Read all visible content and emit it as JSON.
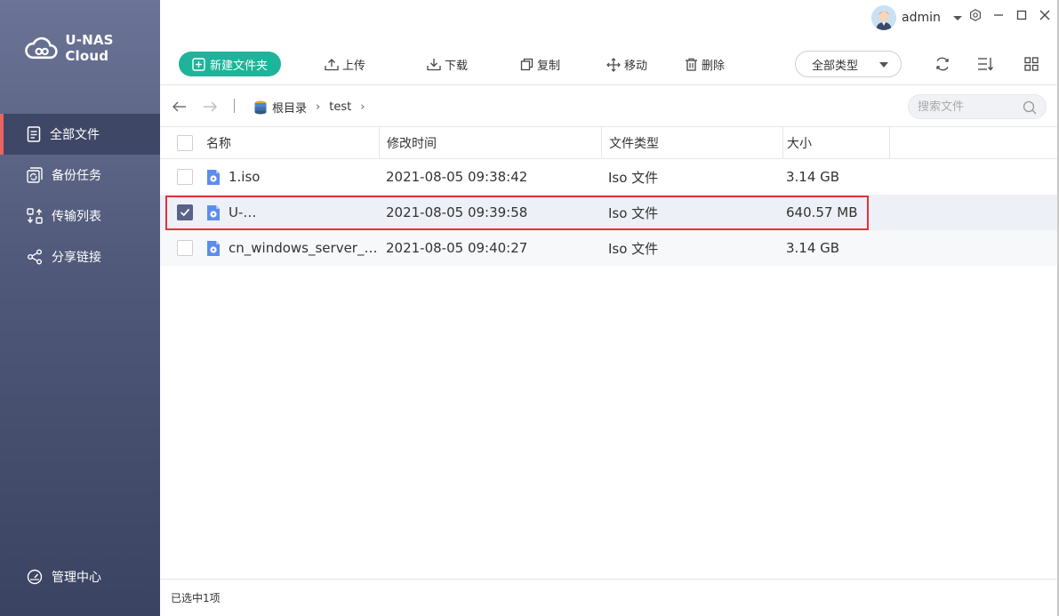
{
  "app": {
    "logo_text": "U-NAS Cloud"
  },
  "sidebar": {
    "items": [
      {
        "label": "全部文件",
        "icon": "document-icon",
        "active": true
      },
      {
        "label": "备份任务",
        "icon": "backup-icon",
        "active": false
      },
      {
        "label": "传输列表",
        "icon": "transfer-icon",
        "active": false
      },
      {
        "label": "分享链接",
        "icon": "share-icon",
        "active": false
      }
    ],
    "bottom_item": {
      "label": "管理中心",
      "icon": "dashboard-icon"
    }
  },
  "topbar": {
    "user_name": "admin"
  },
  "toolbar": {
    "new_folder": "新建文件夹",
    "upload": "上传",
    "download": "下载",
    "copy": "复制",
    "move": "移动",
    "delete": "删除",
    "type_filter": "全部类型"
  },
  "breadcrumb": {
    "root": "根目录",
    "current": "test"
  },
  "search": {
    "placeholder": "搜索文件"
  },
  "table": {
    "headers": {
      "name": "名称",
      "modified": "修改时间",
      "type": "文件类型",
      "size": "大小"
    },
    "rows": [
      {
        "name": "1.iso",
        "modified": "2021-08-05 09:38:42",
        "type": "Iso 文件",
        "size": "3.14 GB",
        "checked": false
      },
      {
        "name": "U-…",
        "modified": "2021-08-05 09:39:58",
        "type": "Iso 文件",
        "size": "640.57 MB",
        "checked": true
      },
      {
        "name": "cn_windows_server_…",
        "modified": "2021-08-05 09:40:27",
        "type": "Iso 文件",
        "size": "3.14 GB",
        "checked": false
      }
    ]
  },
  "status": {
    "selection_text": "已选中1项"
  },
  "colors": {
    "accent": "#1fb39a",
    "sidebar_active_marker": "#ec6363",
    "highlight_box": "#e0333a"
  }
}
